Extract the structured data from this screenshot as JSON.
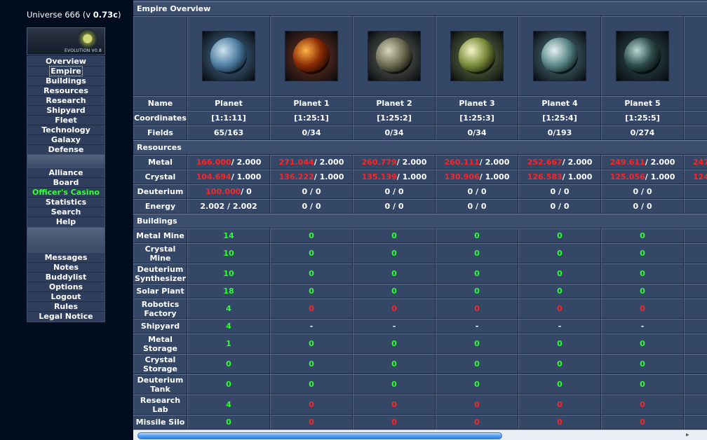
{
  "app": {
    "universe_title_prefix": "Universe 666 (v ",
    "universe_title_version": "0.73c",
    "universe_title_suffix": ")",
    "logo_text": "EVOLUTION V0.8"
  },
  "menu": {
    "group1": [
      "Overview",
      "Empire",
      "Buildings",
      "Resources",
      "Research",
      "Shipyard",
      "Fleet",
      "Technology",
      "Galaxy",
      "Defense"
    ],
    "group2": [
      "Alliance",
      "Board",
      "Officer's Casino",
      "Statistics",
      "Search",
      "Help"
    ],
    "group3": [
      "Messages",
      "Notes",
      "Buddylist",
      "Options",
      "Logout",
      "Rules",
      "Legal Notice"
    ],
    "current": "Empire"
  },
  "empire": {
    "title": "Empire Overview",
    "planets": [
      {
        "name": "Planet",
        "coords": "[1:1:11]",
        "fields": "65/163"
      },
      {
        "name": "Planet 1",
        "coords": "[1:25:1]",
        "fields": "0/34"
      },
      {
        "name": "Planet 2",
        "coords": "[1:25:2]",
        "fields": "0/34"
      },
      {
        "name": "Planet 3",
        "coords": "[1:25:3]",
        "fields": "0/34"
      },
      {
        "name": "Planet 4",
        "coords": "[1:25:4]",
        "fields": "0/193"
      },
      {
        "name": "Planet 5",
        "coords": "[1:25:5]",
        "fields": "0/274"
      }
    ],
    "row_labels": {
      "name": "Name",
      "coordinates": "Coordinates",
      "fields": "Fields"
    },
    "resources": {
      "header": "Resources",
      "rows": [
        {
          "label": "Metal",
          "values": [
            [
              "166.000",
              " / 2.000"
            ],
            [
              "271.044",
              " / 2.000"
            ],
            [
              "260.779",
              " / 2.000"
            ],
            [
              "260.111",
              " / 2.000"
            ],
            [
              "252.667",
              " / 2.000"
            ],
            [
              "249.611",
              " / 2.000"
            ]
          ]
        },
        {
          "label": "Crystal",
          "values": [
            [
              "104.694",
              " / 1.000"
            ],
            [
              "136.222",
              " / 1.000"
            ],
            [
              "135.139",
              " / 1.000"
            ],
            [
              "130.906",
              " / 1.000"
            ],
            [
              "126.583",
              " / 1.000"
            ],
            [
              "125.056",
              " / 1.000"
            ]
          ]
        },
        {
          "label": "Deuterium",
          "values": [
            [
              "100.000",
              " / 0"
            ],
            [
              "",
              "0 / 0"
            ],
            [
              "",
              "0 / 0"
            ],
            [
              "",
              "0 / 0"
            ],
            [
              "",
              "0 / 0"
            ],
            [
              "",
              "0 / 0"
            ]
          ]
        },
        {
          "label": "Energy",
          "values": [
            [
              "",
              "2.002 / 2.002"
            ],
            [
              "",
              "0 / 0"
            ],
            [
              "",
              "0 / 0"
            ],
            [
              "",
              "0 / 0"
            ],
            [
              "",
              "0 / 0"
            ],
            [
              "",
              "0 / 0"
            ]
          ]
        }
      ],
      "partial_metal": "247",
      "partial_crystal": "124"
    },
    "buildings": {
      "header": "Buildings",
      "rows": [
        {
          "label": "Metal Mine",
          "values": [
            "14",
            "0",
            "0",
            "0",
            "0",
            "0"
          ],
          "colors": [
            "g",
            "g",
            "g",
            "g",
            "g",
            "g"
          ]
        },
        {
          "label": "Crystal Mine",
          "values": [
            "10",
            "0",
            "0",
            "0",
            "0",
            "0"
          ],
          "colors": [
            "g",
            "g",
            "g",
            "g",
            "g",
            "g"
          ]
        },
        {
          "label": "Deuterium Synthesizer",
          "values": [
            "10",
            "0",
            "0",
            "0",
            "0",
            "0"
          ],
          "colors": [
            "g",
            "g",
            "g",
            "g",
            "g",
            "g"
          ]
        },
        {
          "label": "Solar Plant",
          "values": [
            "18",
            "0",
            "0",
            "0",
            "0",
            "0"
          ],
          "colors": [
            "g",
            "g",
            "g",
            "g",
            "g",
            "g"
          ]
        },
        {
          "label": "Robotics Factory",
          "values": [
            "4",
            "0",
            "0",
            "0",
            "0",
            "0"
          ],
          "colors": [
            "g",
            "r",
            "r",
            "r",
            "r",
            "r"
          ]
        },
        {
          "label": "Shipyard",
          "values": [
            "4",
            "-",
            "-",
            "-",
            "-",
            "-"
          ],
          "colors": [
            "g",
            "w",
            "w",
            "w",
            "w",
            "w"
          ]
        },
        {
          "label": "Metal Storage",
          "values": [
            "1",
            "0",
            "0",
            "0",
            "0",
            "0"
          ],
          "colors": [
            "g",
            "g",
            "g",
            "g",
            "g",
            "g"
          ]
        },
        {
          "label": "Crystal Storage",
          "values": [
            "0",
            "0",
            "0",
            "0",
            "0",
            "0"
          ],
          "colors": [
            "g",
            "g",
            "g",
            "g",
            "g",
            "g"
          ]
        },
        {
          "label": "Deuterium Tank",
          "values": [
            "0",
            "0",
            "0",
            "0",
            "0",
            "0"
          ],
          "colors": [
            "g",
            "g",
            "g",
            "g",
            "g",
            "g"
          ]
        },
        {
          "label": "Research Lab",
          "values": [
            "4",
            "0",
            "0",
            "0",
            "0",
            "0"
          ],
          "colors": [
            "g",
            "r",
            "r",
            "r",
            "r",
            "r"
          ]
        },
        {
          "label": "Missile Silo",
          "values": [
            "0",
            "0",
            "0",
            "0",
            "0",
            "0"
          ],
          "colors": [
            "g",
            "r",
            "r",
            "r",
            "r",
            "r"
          ]
        }
      ]
    }
  },
  "planet_visuals": [
    {
      "icon": "blue-planet-icon",
      "colors": [
        "#cfe3ee",
        "#4f7fa4",
        "#0c1a2a"
      ]
    },
    {
      "icon": "orange-planet-icon",
      "colors": [
        "#ffb347",
        "#8a2b05",
        "#120503"
      ]
    },
    {
      "icon": "grey-planet-icon",
      "colors": [
        "#d8d6bd",
        "#6d6b52",
        "#0b0b08"
      ]
    },
    {
      "icon": "green-planet-icon",
      "colors": [
        "#f3f7c7",
        "#7b8a3a",
        "#0d1406"
      ]
    },
    {
      "icon": "teal-planet-icon",
      "colors": [
        "#e6f1f0",
        "#5a8789",
        "#081214"
      ]
    },
    {
      "icon": "dark-planet-icon",
      "colors": [
        "#b9d8d3",
        "#2e4c4b",
        "#040908"
      ]
    }
  ]
}
